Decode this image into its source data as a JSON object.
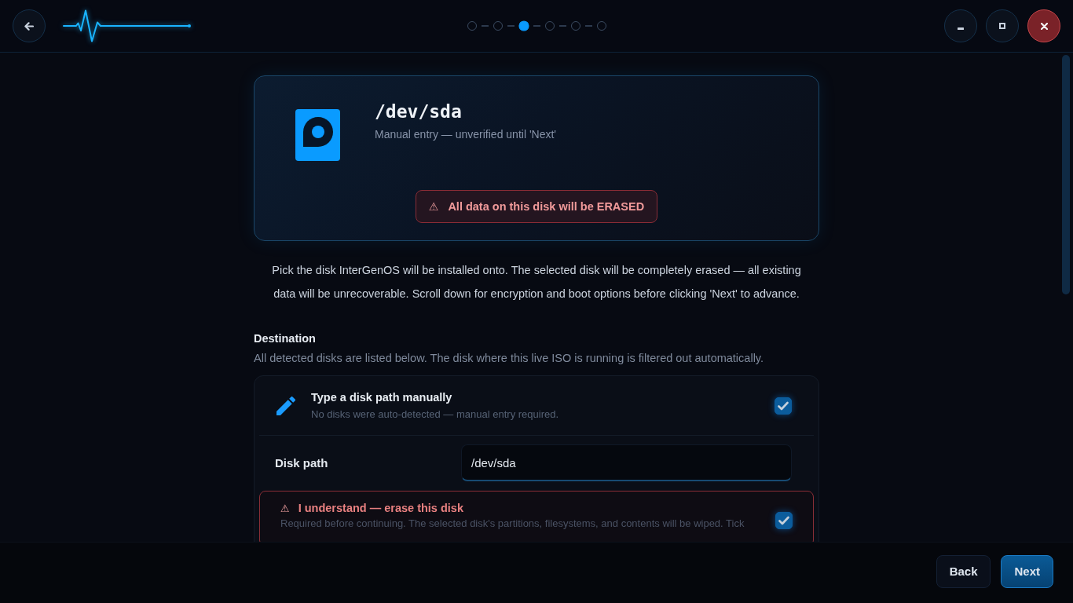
{
  "header": {
    "steps": [
      {
        "selected": false
      },
      {
        "selected": false
      },
      {
        "selected": true
      },
      {
        "selected": false
      },
      {
        "selected": false
      },
      {
        "selected": false
      }
    ]
  },
  "disk_card": {
    "title": "/dev/sda",
    "subtitle": "Manual entry — unverified until 'Next'",
    "warning": {
      "icon": "⚠",
      "text": "All data on this disk will be ERASED"
    }
  },
  "intro": "Pick the disk InterGenOS will be installed onto. The selected disk will be completely erased — all existing data will be unrecoverable. Scroll down for encryption and boot options before clicking 'Next' to advance.",
  "destination": {
    "heading": "Destination",
    "description": "All detected disks are listed below. The disk where this live ISO is running is filtered out automatically."
  },
  "options": [
    {
      "kind": "manual",
      "title": "Type a disk path manually",
      "subtitle": "No disks were auto-detected — manual entry required.",
      "checked": true
    },
    {
      "kind": "field",
      "label": "Disk path",
      "value": "/dev/sda"
    },
    {
      "kind": "confirm",
      "icon": "⚠",
      "title": "I understand — erase this disk",
      "subtitle": "Required before continuing. The selected disk's partitions, filesystems, and contents will be wiped. Tick",
      "checked": true
    }
  ],
  "footer": {
    "buttons": [
      {
        "kind": "secondary",
        "label": "Back"
      },
      {
        "kind": "primary",
        "label": "Next"
      }
    ]
  }
}
